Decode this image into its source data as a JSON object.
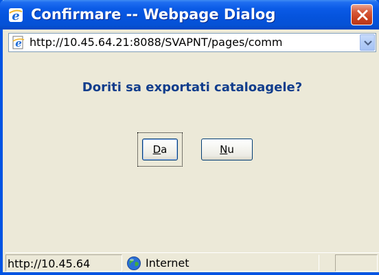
{
  "window": {
    "title": "Confirmare -- Webpage Dialog",
    "title_color": "#ffffff",
    "titlebar_color": "#0553dc",
    "close_button_color": "#c9401e"
  },
  "address_bar": {
    "icon": "ie-page-icon",
    "url": "http://10.45.64.21:8088/SVAPNT/pages/comm",
    "dropdown_icon": "chevron-down-icon"
  },
  "dialog": {
    "question": "Doriti sa exportati cataloagele?",
    "question_color": "#113d8c",
    "buttons": [
      {
        "accel": "D",
        "rest": "a",
        "default": true
      },
      {
        "accel": "N",
        "rest": "u",
        "default": false
      }
    ]
  },
  "status_bar": {
    "url": "http://10.45.64",
    "zone_icon": "globe-icon",
    "zone_label": "Internet"
  }
}
